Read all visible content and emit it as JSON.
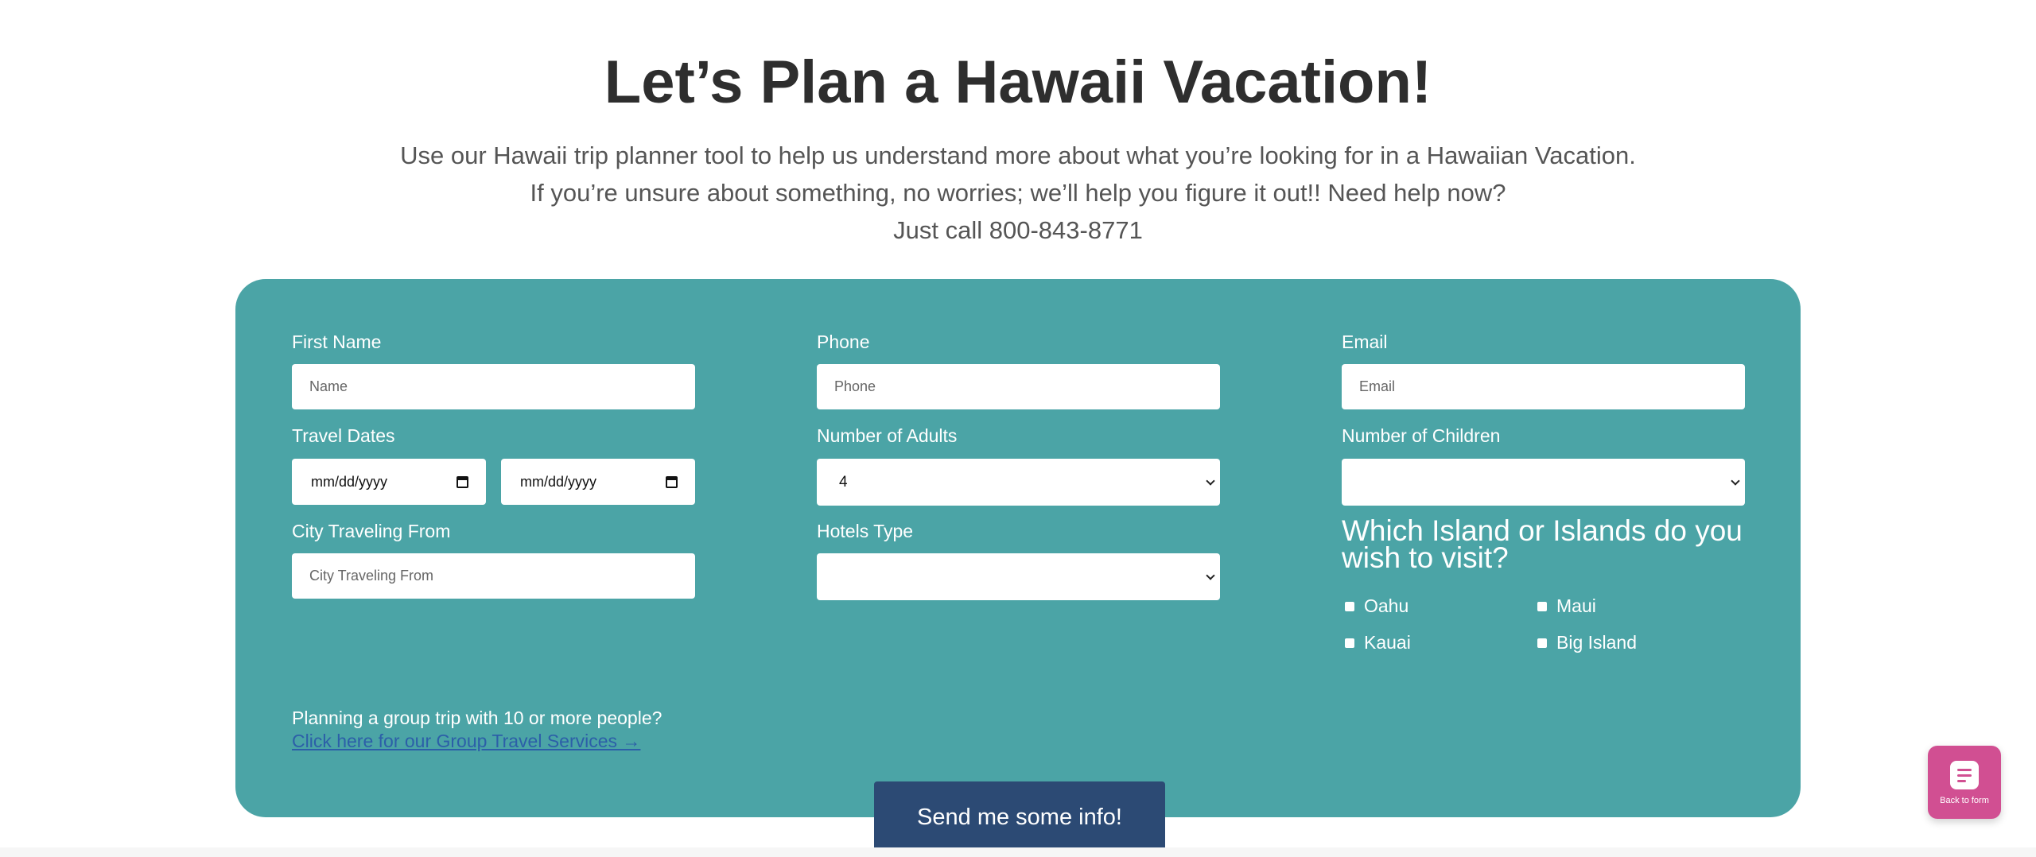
{
  "page": {
    "title": "Let’s Plan a Hawaii Vacation!",
    "intro_lines": [
      "Use our Hawaii trip planner tool to help us understand more about what you’re looking for in a Hawaiian Vacation.",
      "If you’re unsure about something, no worries; we’ll help you figure it out!! Need help now?",
      "Just call 800-843-8771"
    ]
  },
  "form": {
    "background_color": "#4ba4a6",
    "first_name": {
      "label": "First Name",
      "placeholder": "Name",
      "value": ""
    },
    "phone": {
      "label": "Phone",
      "placeholder": "Phone",
      "value": ""
    },
    "email": {
      "label": "Email",
      "placeholder": "Email",
      "value": ""
    },
    "travel_dates": {
      "label": "Travel Dates",
      "start_value": "mm/dd/yyyy",
      "end_value": "mm/dd/yyyy",
      "icon": "calendar-icon"
    },
    "adults": {
      "label": "Number of Adults",
      "value": "4",
      "icon": "chevron-down-icon"
    },
    "children": {
      "label": "Number of Children",
      "value": "",
      "icon": "chevron-down-icon"
    },
    "city": {
      "label": "City Traveling From",
      "placeholder": "City Traveling From",
      "value": ""
    },
    "hotels": {
      "label": "Hotels Type",
      "value": "",
      "icon": "chevron-down-icon"
    },
    "islands": {
      "heading": "Which Island or Islands do you wish to visit?",
      "options": [
        {
          "label": "Oahu",
          "checked": false
        },
        {
          "label": "Maui",
          "checked": false
        },
        {
          "label": "Kauai",
          "checked": false
        },
        {
          "label": "Big Island",
          "checked": false
        }
      ]
    },
    "group": {
      "text": "Planning a group trip with 10 or more people?",
      "link": "Click here for our Group Travel Services →"
    },
    "submit_label": "Send me some info!",
    "submit_color": "#2c4a74"
  },
  "widget": {
    "label": "Back to form",
    "icon": "form-icon",
    "color": "#d14f92"
  }
}
